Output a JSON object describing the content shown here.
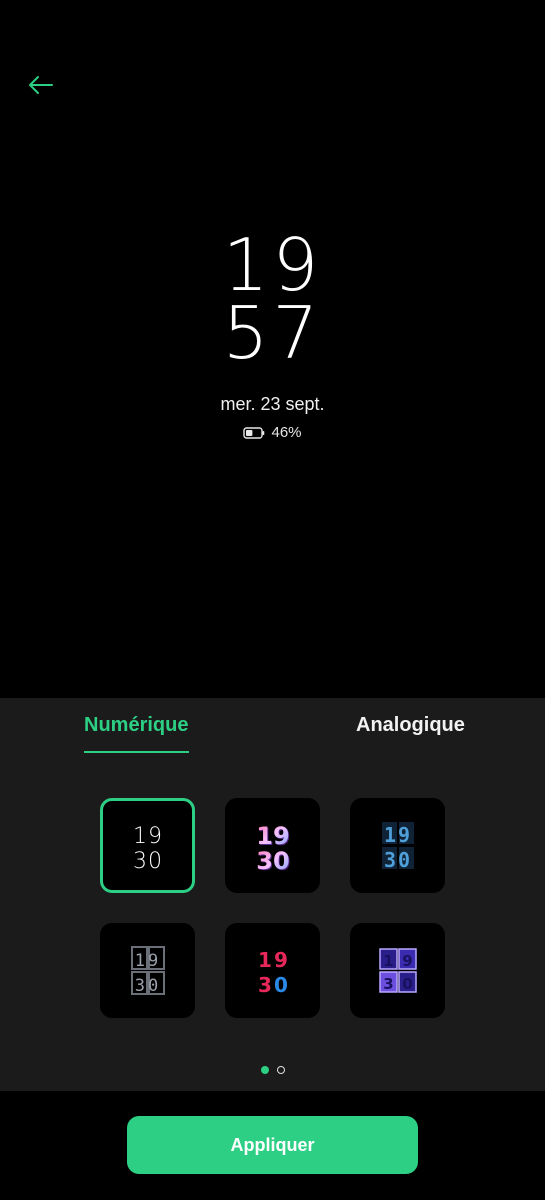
{
  "preview": {
    "hour": "19",
    "minute": "57",
    "date": "mer. 23 sept.",
    "battery_percent": "46%",
    "battery_level": 0.46
  },
  "tabs": {
    "digital_label": "Numérique",
    "analog_label": "Analogique",
    "active": "digital"
  },
  "styles": [
    {
      "name": "thin-minimal",
      "hour": "19",
      "minute": "30",
      "selected": true
    },
    {
      "name": "colorful-3d",
      "hour": "19",
      "minute": "30",
      "selected": false
    },
    {
      "name": "blue-blocks",
      "hour": "19",
      "minute": "30",
      "selected": false
    },
    {
      "name": "segmented-gray",
      "hour": "19",
      "minute": "30",
      "selected": false
    },
    {
      "name": "neon-red-blue",
      "hour": "19",
      "minute": "30",
      "selected": false
    },
    {
      "name": "purple-squares",
      "hour": "19",
      "minute": "30",
      "selected": false
    }
  ],
  "pagination": {
    "current": 1,
    "total": 2
  },
  "apply_label": "Appliquer",
  "colors": {
    "accent": "#2dcf84",
    "panel": "#1b1b1b",
    "background": "#000000"
  }
}
